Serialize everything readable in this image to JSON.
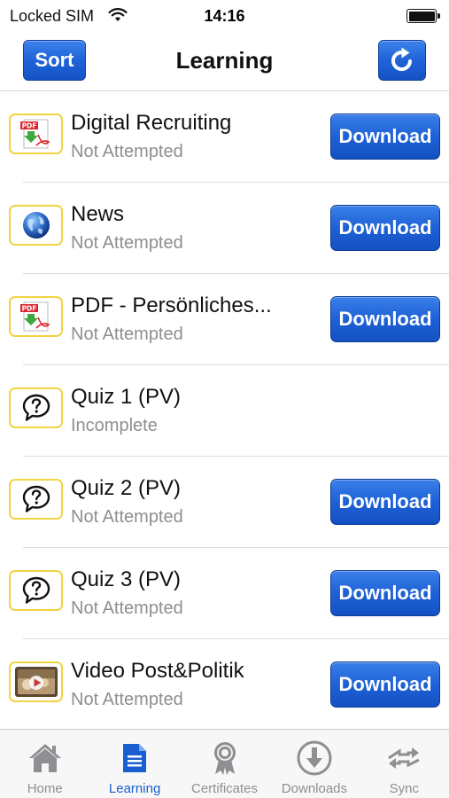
{
  "status_bar": {
    "carrier": "Locked SIM",
    "time": "14:16"
  },
  "nav": {
    "sort_label": "Sort",
    "title": "Learning"
  },
  "accent_color": "#1f63d8",
  "items": [
    {
      "title": "Digital Recruiting",
      "status": "Not Attempted",
      "icon": "pdf-icon",
      "action": "Download"
    },
    {
      "title": "News",
      "status": "Not Attempted",
      "icon": "globe-icon",
      "action": "Download"
    },
    {
      "title": "PDF - Persönliches...",
      "status": "Not Attempted",
      "icon": "pdf-icon",
      "action": "Download"
    },
    {
      "title": "Quiz 1 (PV)",
      "status": "Incomplete",
      "icon": "quiz-icon",
      "action": ""
    },
    {
      "title": "Quiz 2 (PV)",
      "status": "Not Attempted",
      "icon": "quiz-icon",
      "action": "Download"
    },
    {
      "title": "Quiz 3 (PV)",
      "status": "Not Attempted",
      "icon": "quiz-icon",
      "action": "Download"
    },
    {
      "title": "Video Post&Politik",
      "status": "Not Attempted",
      "icon": "video-icon",
      "action": "Download"
    }
  ],
  "tabs": [
    {
      "label": "Home",
      "icon": "home-icon",
      "active": false
    },
    {
      "label": "Learning",
      "icon": "document-icon",
      "active": true
    },
    {
      "label": "Certificates",
      "icon": "ribbon-icon",
      "active": false
    },
    {
      "label": "Downloads",
      "icon": "download-circle-icon",
      "active": false
    },
    {
      "label": "Sync",
      "icon": "sync-icon",
      "active": false
    }
  ]
}
